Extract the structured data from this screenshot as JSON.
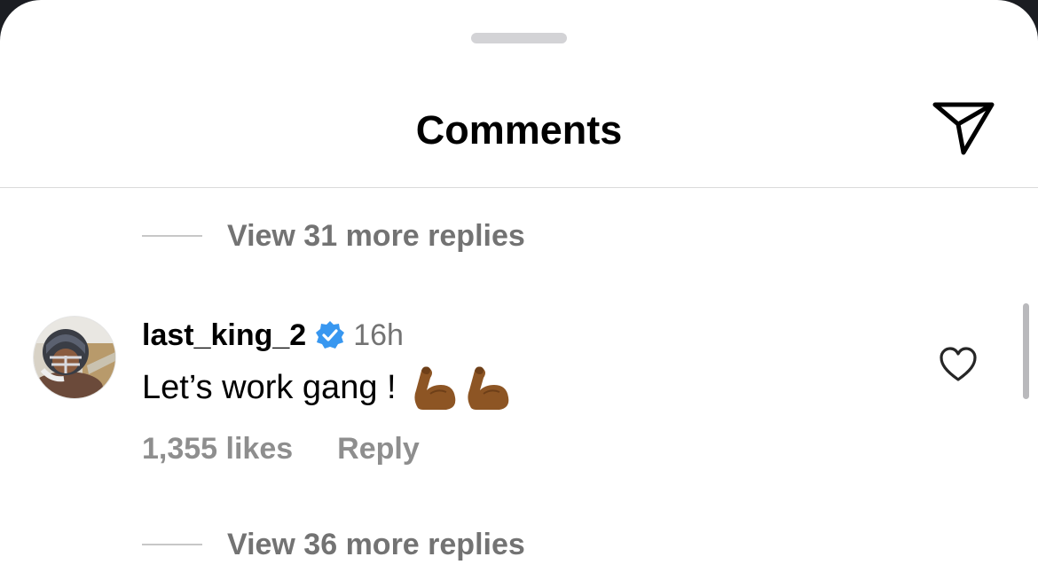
{
  "header": {
    "title": "Comments",
    "share_icon": "paper-plane-icon"
  },
  "replies_top": {
    "label": "View 31 more replies"
  },
  "comment": {
    "username": "last_king_2",
    "verified_icon": "verified-badge-icon",
    "time": "16h",
    "text": "Let’s work gang !",
    "emojis": [
      "flexed-biceps-medium-dark",
      "flexed-biceps-medium-dark"
    ],
    "likes": "1,355 likes",
    "reply_label": "Reply",
    "like_icon": "heart-outline-icon"
  },
  "replies_bottom": {
    "label": "View 36 more replies"
  },
  "colors": {
    "background": "#ffffff",
    "muted_text": "#737373",
    "verified_blue": "#3897f0",
    "emoji_skin": "#8d5524"
  }
}
